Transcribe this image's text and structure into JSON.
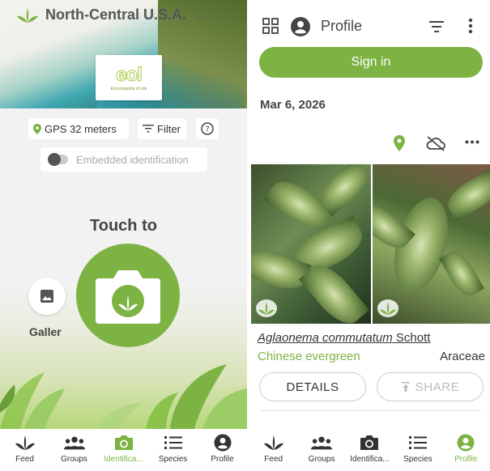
{
  "left": {
    "region": "North-Central U.S.A.",
    "logo_text": "eol",
    "logo_sub": "Encyclopedia of Life",
    "gps_label": "GPS 32 meters",
    "filter_label": "Filter",
    "help_label": "?",
    "embedded_label": "Embedded identification",
    "touch_text": "Touch to",
    "gallery_label": "Galler"
  },
  "right": {
    "title": "Profile",
    "signin_label": "Sign in",
    "date": "Mar 6, 2026",
    "observation": {
      "scientific_name": "Aglaonema commutatum",
      "author": " Schott",
      "common_name": "Chinese evergreen",
      "family": "Araceae"
    },
    "details_label": "DETAILS",
    "share_label": "SHARE"
  },
  "nav_left": [
    {
      "label": "Feed",
      "icon": "feed-icon"
    },
    {
      "label": "Groups",
      "icon": "groups-icon"
    },
    {
      "label": "Identifica...",
      "icon": "camera-icon",
      "active": true
    },
    {
      "label": "Species",
      "icon": "species-icon"
    },
    {
      "label": "Profile",
      "icon": "profile-icon"
    }
  ],
  "nav_right": [
    {
      "label": "Feed",
      "icon": "feed-icon"
    },
    {
      "label": "Groups",
      "icon": "groups-icon"
    },
    {
      "label": "Identifica...",
      "icon": "camera-icon"
    },
    {
      "label": "Species",
      "icon": "species-icon"
    },
    {
      "label": "Profile",
      "icon": "profile-icon",
      "active": true
    }
  ],
  "colors": {
    "accent": "#7cb342",
    "text": "#444444"
  }
}
